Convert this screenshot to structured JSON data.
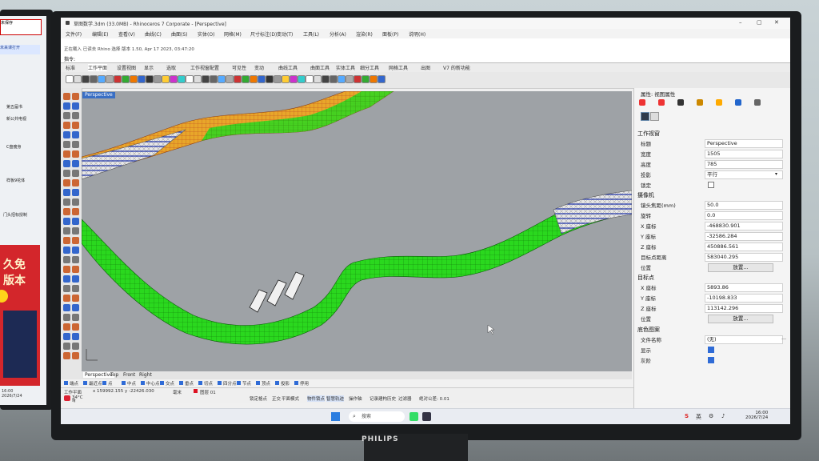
{
  "background": {
    "left_monitor_items": [
      "未保存",
      "未来课打开",
      "第五届书",
      "新公共电视",
      "C盘瘦身",
      "样板9花体",
      "门头招标授制"
    ],
    "ad_lines": [
      "久免",
      "版本"
    ],
    "left_clock": "16:00",
    "left_date": "2026/7/24",
    "brand": "PHILIPS"
  },
  "window": {
    "title": "草图数学.3dm (33.0MB) - Rhinoceros 7 Corporate - [Perspective]"
  },
  "menu": [
    "文件(F)",
    "编辑(E)",
    "查看(V)",
    "曲线(C)",
    "曲面(S)",
    "实体(O)",
    "网格(M)",
    "尺寸标注(D)",
    "变动(T)",
    "工具(L)",
    "分析(A)",
    "渲染(R)",
    "面板(P)",
    "说明(H)"
  ],
  "command": {
    "history": "正在载入 已读去 Rhino 选择 版本 1.50, Apr 17 2023, 03:47:20",
    "prompt": "指令:"
  },
  "tabs": [
    "标准",
    "工作平面",
    "设置视图",
    "显示",
    "选取",
    "工作视窗配置",
    "可见性",
    "变动",
    "曲线工具",
    "曲面工具",
    "实体工具",
    "细分工具",
    "网格工具",
    "出图",
    "V7 的新功能"
  ],
  "viewport": {
    "label": "Perspective"
  },
  "viewport_tabs": [
    "Perspective",
    "Top",
    "Front",
    "Right"
  ],
  "osnap": [
    "端点",
    "最近点",
    "点",
    "中点",
    "中心点",
    "交点",
    "垂点",
    "切点",
    "四分点",
    "节点",
    "顶点",
    "投影",
    "停用"
  ],
  "status": {
    "plane": "工作平面",
    "coords": "x 159992.155  y -22426.030",
    "unit": "毫米",
    "layer": "图层 01",
    "toggles": [
      "锁定格点",
      "正交",
      "平面模式",
      "物件锁点",
      "智慧轨迹",
      "操作轴",
      "记录建构历史",
      "过滤器",
      "绝对公差: 0.01"
    ],
    "temp": "34°C",
    "weather": "晴"
  },
  "panel": {
    "header": "属性: 视图属性",
    "section_view": "工作视窗",
    "title_label": "标题",
    "title_value": "Perspective",
    "width_label": "宽度",
    "width_value": "1505",
    "height_label": "高度",
    "height_value": "785",
    "proj_label": "投影",
    "proj_value": "平行",
    "lock_label": "锁定",
    "section_camera": "摄像机",
    "lens_label": "镜头焦距(mm)",
    "lens_value": "50.0",
    "rot_label": "旋转",
    "rot_value": "0.0",
    "cx_label": "X 座标",
    "cx_value": "-468830.901",
    "cy_label": "Y 座标",
    "cy_value": "-32586.284",
    "cz_label": "Z 座标",
    "cz_value": "450886.561",
    "dist_label": "目标点距离",
    "dist_value": "583040.295",
    "pos_label": "位置",
    "pos_button": "放置...",
    "section_target": "目标点",
    "tx_label": "X 座标",
    "tx_value": "5893.86",
    "ty_label": "Y 座标",
    "ty_value": "-10198.833",
    "tz_label": "Z 座标",
    "tz_value": "113142.296",
    "tpos_label": "位置",
    "tpos_button": "放置...",
    "section_bg": "底色图案",
    "file_label": "文件名称",
    "file_value": "(无)",
    "show_label": "显示",
    "gray_label": "灰阶"
  },
  "taskbar": {
    "search": "搜索",
    "tray": [
      "英"
    ],
    "time": "16:00",
    "date": "2026/7/24"
  },
  "colors": {
    "tube_green": "#2ad81e",
    "tube_orange": "#e8a62a",
    "viewport_bg": "#9ea2a6",
    "accent_blue": "#2f6bd6"
  }
}
